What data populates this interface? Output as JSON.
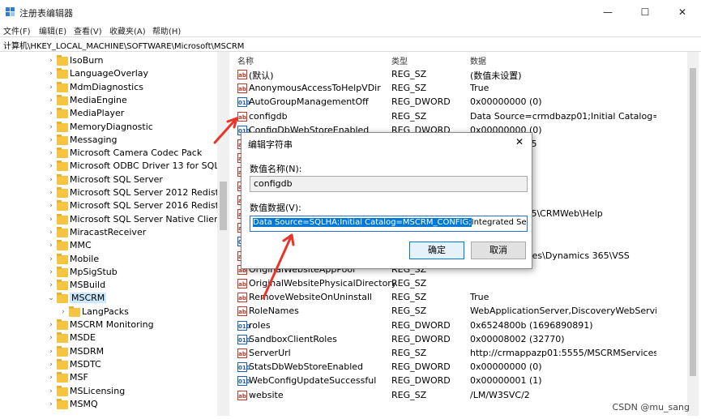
{
  "window": {
    "title": "注册表编辑器",
    "minimize": "—",
    "maximize": "☐",
    "close": "✕"
  },
  "menu": [
    "文件(F)",
    "编辑(E)",
    "查看(V)",
    "收藏夹(A)",
    "帮助(H)"
  ],
  "address": "计算机\\HKEY_LOCAL_MACHINE\\SOFTWARE\\Microsoft\\MSCRM",
  "tree": [
    {
      "label": "IsoBurn",
      "indent": 0
    },
    {
      "label": "LanguageOverlay",
      "indent": 0
    },
    {
      "label": "MdmDiagnostics",
      "indent": 0
    },
    {
      "label": "MediaEngine",
      "indent": 0
    },
    {
      "label": "MediaPlayer",
      "indent": 0
    },
    {
      "label": "MemoryDiagnostic",
      "indent": 0
    },
    {
      "label": "Messaging",
      "indent": 0
    },
    {
      "label": "Microsoft Camera Codec Pack",
      "indent": 0
    },
    {
      "label": "Microsoft ODBC Driver 13 for SQL Ser",
      "indent": 0
    },
    {
      "label": "Microsoft SQL Server",
      "indent": 0
    },
    {
      "label": "Microsoft SQL Server 2012 Redist",
      "indent": 0
    },
    {
      "label": "Microsoft SQL Server 2016 Redist",
      "indent": 0
    },
    {
      "label": "Microsoft SQL Server Native Client 11.(",
      "indent": 0
    },
    {
      "label": "MiracastReceiver",
      "indent": 0
    },
    {
      "label": "MMC",
      "indent": 0
    },
    {
      "label": "Mobile",
      "indent": 0
    },
    {
      "label": "MpSigStub",
      "indent": 0
    },
    {
      "label": "MSBuild",
      "indent": 0
    },
    {
      "label": "MSCRM",
      "indent": 0,
      "expanded": true,
      "selected": true
    },
    {
      "label": "LangPacks",
      "indent": 1
    },
    {
      "label": "MSCRM Monitoring",
      "indent": 0
    },
    {
      "label": "MSDE",
      "indent": 0
    },
    {
      "label": "MSDRM",
      "indent": 0
    },
    {
      "label": "MSDTC",
      "indent": 0
    },
    {
      "label": "MSF",
      "indent": 0
    },
    {
      "label": "MSLicensing",
      "indent": 0
    },
    {
      "label": "MSMQ",
      "indent": 0
    }
  ],
  "columns": {
    "name": "名称",
    "type": "类型",
    "data": "数据"
  },
  "values": [
    {
      "name": "(默认)",
      "type": "REG_SZ",
      "data": "(数值未设置)",
      "icon": "ab"
    },
    {
      "name": "AnonymousAccessToHelpVDir",
      "type": "REG_SZ",
      "data": "True",
      "icon": "ab"
    },
    {
      "name": "AutoGroupManagementOff",
      "type": "REG_DWORD",
      "data": "0x00000000 (0)",
      "icon": "010"
    },
    {
      "name": "configdb",
      "type": "REG_SZ",
      "data": "Data Source=crmdbazp01;Initial Catalog=MS...",
      "icon": "ab"
    },
    {
      "name": "ConfigDbWebStoreEnabled",
      "type": "REG_DWORD",
      "data": "0x00000000 (0)",
      "icon": "010"
    },
    {
      "name": "",
      "type": "",
      "data": "\\Dynamics 365",
      "icon": "ab"
    },
    {
      "name": "",
      "type": "",
      "data": "",
      "icon": "ab"
    },
    {
      "name": "",
      "type": "",
      "data": "",
      "icon": "ab"
    },
    {
      "name": "",
      "type": "",
      "data": "",
      "icon": "ab"
    },
    {
      "name": "",
      "type": "",
      "data": "",
      "icon": "ab"
    },
    {
      "name": "",
      "type": "",
      "data": "\\Dynamics 365\\CRMWeb\\Help",
      "icon": "ab"
    },
    {
      "name": "",
      "type": "",
      "data": "",
      "icon": "ab"
    },
    {
      "name": "",
      "type": "",
      "data": "5)",
      "icon": "010"
    },
    {
      "name": "ManifestBackupPath",
      "type": "REG_SZ",
      "data": "C:\\Program Files\\Dynamics 365\\VSS",
      "icon": "ab"
    },
    {
      "name": "OriginalWebsiteAppPool",
      "type": "REG_SZ",
      "data": "",
      "icon": "ab"
    },
    {
      "name": "OriginalWebsitePhysicalDirectory",
      "type": "REG_SZ",
      "data": "",
      "icon": "ab"
    },
    {
      "name": "RemoveWebsiteOnUninstall",
      "type": "REG_SZ",
      "data": "True",
      "icon": "ab"
    },
    {
      "name": "RoleNames",
      "type": "REG_SZ",
      "data": "WebApplicationServer,DiscoveryWebService,...",
      "icon": "ab"
    },
    {
      "name": "roles",
      "type": "REG_DWORD",
      "data": "0x6524800b (1696890891)",
      "icon": "010"
    },
    {
      "name": "SandboxClientRoles",
      "type": "REG_DWORD",
      "data": "0x00008002 (32770)",
      "icon": "010"
    },
    {
      "name": "ServerUrl",
      "type": "REG_SZ",
      "data": "http://crmappazp01:5555/MSCRMServices",
      "icon": "ab"
    },
    {
      "name": "StatsDbWebStoreEnabled",
      "type": "REG_DWORD",
      "data": "0x00000000 (0)",
      "icon": "010"
    },
    {
      "name": "WebConfigUpdateSuccessful",
      "type": "REG_DWORD",
      "data": "0x00000001 (1)",
      "icon": "010"
    },
    {
      "name": "website",
      "type": "REG_SZ",
      "data": "/LM/W3SVC/2",
      "icon": "ab"
    }
  ],
  "dialog": {
    "title": "编辑字符串",
    "close": "✕",
    "name_label": "数值名称(N):",
    "name_value": "configdb",
    "data_label": "数值数据(V):",
    "data_selected": "Data Source=SQLHA;Initial Catalog=MSCRM_CONFIG;",
    "data_rest": "Integrated Securi",
    "ok": "确定",
    "cancel": "取消"
  },
  "watermark": "CSDN @mu_sang",
  "accent": "#0078d7",
  "arrow_color": "#e8352a"
}
